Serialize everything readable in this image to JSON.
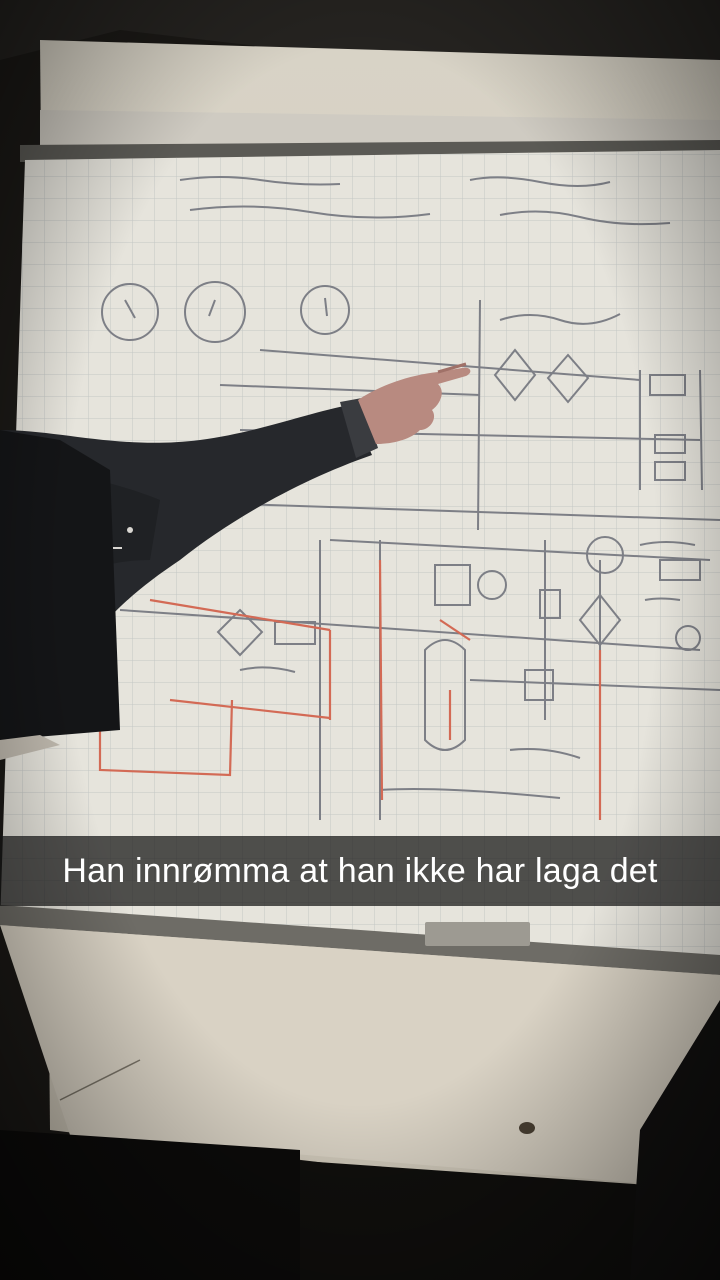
{
  "caption": {
    "text": "Han innrømma at han ikke har laga det"
  },
  "colors": {
    "caption_bar": "#141414",
    "caption_text": "#ffffff",
    "whiteboard": "#e6e4dc",
    "grid_line": "#b9bdbd",
    "pencil": "#7d7f86",
    "red_marker": "#d36a55",
    "sleeve": "#26282c"
  }
}
